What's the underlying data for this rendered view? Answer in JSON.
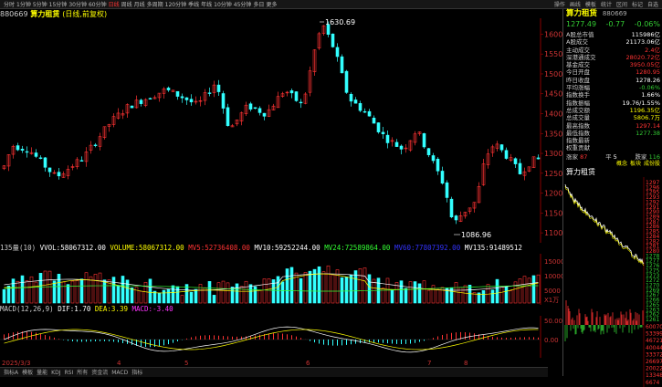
{
  "topbar": {
    "tabs": [
      "分时",
      "1分钟",
      "5分钟",
      "15分钟",
      "30分钟",
      "60分钟",
      "日线",
      "周线",
      "月线",
      "多周期",
      "120分钟",
      "季线",
      "年线",
      "10分钟",
      "45分钟",
      "多日",
      "更多"
    ],
    "active_index": 6,
    "right": [
      "操作",
      "画线",
      "模板",
      "统计",
      "区间",
      "标记",
      "自选"
    ]
  },
  "title": {
    "code": "880669",
    "name": "算力租赁",
    "period": "(日线,前复权)"
  },
  "price_labels": {
    "high": "1630.69",
    "low": "1086.96"
  },
  "y_axis_main": [
    "1600",
    "1550",
    "1500",
    "1450",
    "1400",
    "1350",
    "1300",
    "1250",
    "1200",
    "1150",
    "1100"
  ],
  "volume_indicator": {
    "name": "135量(10)",
    "vvol_label": "VVOL:",
    "vvol": "58067312.00",
    "volume_label": "VOLUME:",
    "volume": "58067312.00",
    "mv5_label": "MV5:",
    "mv5": "52736408.00",
    "mv10_label": "MV10:",
    "mv10": "59252244.00",
    "mv24_label": "MV24:",
    "mv24": "72589864.00",
    "mv60_label": "MV60:",
    "mv60": "77807392.00",
    "mv135_label": "MV135:",
    "mv135": "91489512",
    "y_axis": [
      "15000",
      "10000",
      "5000"
    ],
    "unit": "X1万"
  },
  "macd_indicator": {
    "name": "MACD(12,26,9)",
    "dif_label": "DIF:",
    "dif": "1.70",
    "dea_label": "DEA:",
    "dea": "3.39",
    "macd_label": "MACD:",
    "macd": "-3.40",
    "y_axis": [
      "50.00",
      "0.00"
    ]
  },
  "date_axis": {
    "start": "2025/3/3",
    "months": [
      "4",
      "5",
      "6",
      "7",
      "8"
    ]
  },
  "bottombar": [
    "指标A",
    "模板",
    "量能",
    "KDJ",
    "RSI",
    "所有",
    "资金流",
    "MACD",
    "指标"
  ],
  "right_panel": {
    "name": "算力租赁",
    "code": "880669",
    "price": "1277.49",
    "change": "-0.77",
    "change_pct": "-0.06%",
    "rows": [
      {
        "label": "A股总市值",
        "value": "115986亿",
        "color": "white"
      },
      {
        "label": "A股成交",
        "value": "21173.06亿",
        "color": "white"
      },
      {
        "label": "主动成交",
        "value": "2.4亿",
        "color": "red"
      },
      {
        "label": "深港通成交",
        "value": "28020.72亿",
        "color": "red"
      },
      {
        "label": "基金成交",
        "value": "3950.05亿",
        "color": "red"
      },
      {
        "label": "今日开盘",
        "value": "1280.95",
        "color": "red"
      },
      {
        "label": "昨日收盘",
        "value": "1278.26",
        "color": "white"
      },
      {
        "label": "平均涨幅",
        "value": "-0.06%",
        "color": "green"
      },
      {
        "label": "指数换手",
        "value": "1.66%",
        "color": "white"
      },
      {
        "label": "指数振幅",
        "value": "19.76/1.55%",
        "color": "white"
      },
      {
        "label": "总成交额",
        "value": "1196.35亿",
        "color": "yellow"
      },
      {
        "label": "总成交量",
        "value": "5806.7万",
        "color": "yellow"
      },
      {
        "label": "最高指数",
        "value": "1297.14",
        "color": "red"
      },
      {
        "label": "最低指数",
        "value": "1277.38",
        "color": "green"
      },
      {
        "label": "指数最新",
        "value": "",
        "color": "white"
      },
      {
        "label": "权重贡献",
        "value": "",
        "color": "white"
      }
    ],
    "updown": {
      "up_label": "涨家",
      "up": "87",
      "eq_label": "平",
      "eq": "5",
      "down_label": "跌家",
      "down": "116"
    },
    "sub_tabs": [
      "概念",
      "板块",
      "成份股"
    ],
    "mini_name": "算力租赁",
    "mini_axis": [
      "1297",
      "1296",
      "1295",
      "1293",
      "1292",
      "1291",
      "1290",
      "1289",
      "1287",
      "1286",
      "1285",
      "1284",
      "1282",
      "1281",
      "1280",
      "1278",
      "1277",
      "1276",
      "1275",
      "1273",
      "1272",
      "1270",
      "1269",
      "1267",
      "1266",
      "1265",
      "1263",
      "1262",
      "1261"
    ],
    "vol_axis": [
      "60070",
      "53399",
      "46721",
      "40044",
      "33372",
      "26697",
      "20022",
      "13348",
      "6674"
    ]
  },
  "colors": {
    "up": "#ff3333",
    "down": "#33ffff",
    "accent": "#ffff00"
  }
}
